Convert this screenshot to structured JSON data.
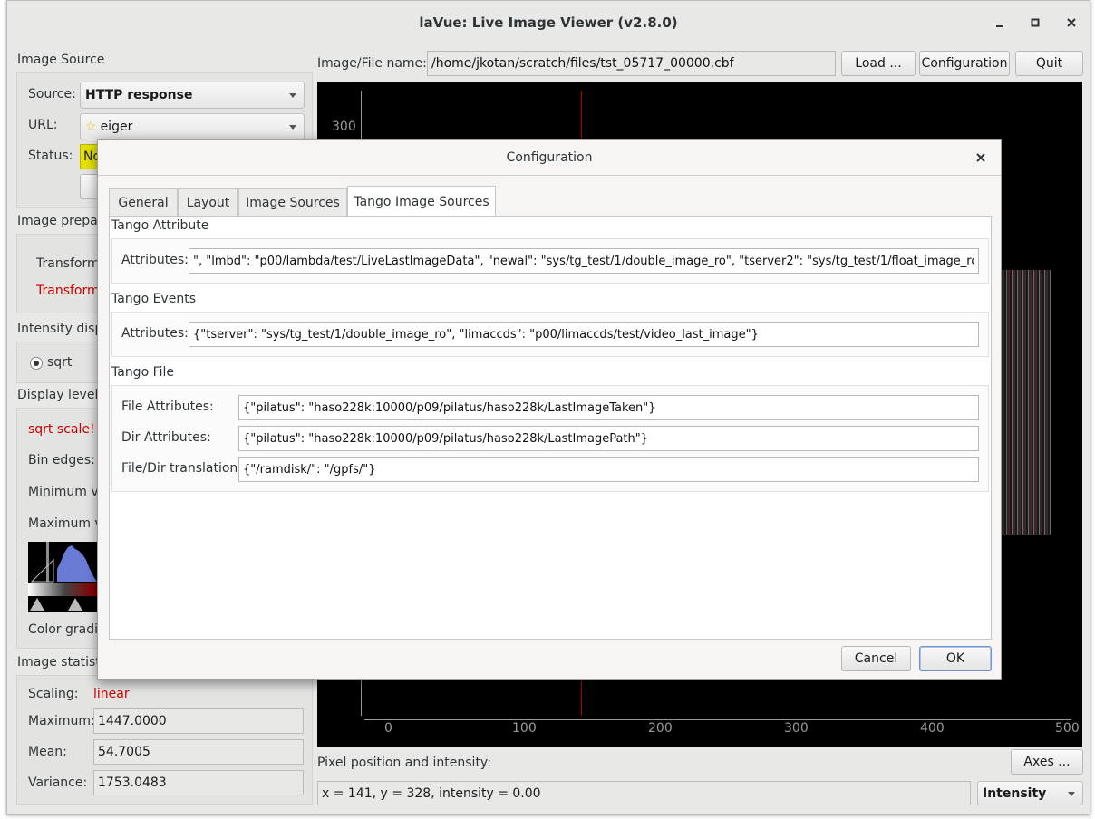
{
  "window": {
    "title": "laVue: Live Image Viewer (v2.8.0)",
    "controls": [
      "minimize-icon",
      "maximize-icon",
      "close-icon"
    ]
  },
  "left": {
    "image_source": {
      "title": "Image Source",
      "source_label": "Source:",
      "source_value": "HTTP response",
      "url_label": "URL:",
      "url_value": "eiger",
      "status_label": "Status:",
      "status_value": "No"
    },
    "image_preparation": {
      "title": "Image prepara",
      "transform_label": "Transforma",
      "transform_red": "Transform"
    },
    "intensity": {
      "title": "Intensity displ",
      "radio_label": "sqrt"
    },
    "display_levels": {
      "title": "Display levels",
      "scale_note": "sqrt scale!",
      "bin_edges_label": "Bin edges:",
      "min_label": "Minimum va",
      "max_label": "Maximum va",
      "gradient_label": "Color gradie"
    },
    "statistics": {
      "title": "Image statistic",
      "scaling_label": "Scaling:",
      "scaling_value": "linear",
      "maximum_label": "Maximum:",
      "maximum_value": "1447.0000",
      "mean_label": "Mean:",
      "mean_value": "54.7005",
      "variance_label": "Variance:",
      "variance_value": "1753.0483"
    }
  },
  "top": {
    "file_label": "Image/File name:",
    "file_value": "/home/jkotan/scratch/files/tst_05717_00000.cbf",
    "load_label": "Load ...",
    "config_label": "Configuration",
    "quit_label": "Quit"
  },
  "plot": {
    "y_tick_top": "300",
    "x_ticks": [
      "0",
      "100",
      "200",
      "300",
      "400",
      "500"
    ]
  },
  "bottom": {
    "pixel_label": "Pixel position and intensity:",
    "axes_label": "Axes ...",
    "pixel_value": "x = 141, y = 328, intensity = 0.00",
    "mode_value": "Intensity"
  },
  "dialog": {
    "title": "Configuration",
    "tabs": [
      "General",
      "Layout",
      "Image Sources",
      "Tango Image Sources"
    ],
    "active_tab": "Tango Image Sources",
    "tango_attribute": {
      "title": "Tango Attribute",
      "attributes_label": "Attributes:",
      "attributes_value": "\", \"lmbd\": \"p00/lambda/test/LiveLastImageData\", \"newal\": \"sys/tg_test/1/double_image_ro\", \"tserver2\": \"sys/tg_test/1/float_image_ro\"}"
    },
    "tango_events": {
      "title": "Tango Events",
      "attributes_label": "Attributes:",
      "attributes_value": "{\"tserver\": \"sys/tg_test/1/double_image_ro\", \"limaccds\": \"p00/limaccds/test/video_last_image\"}"
    },
    "tango_file": {
      "title": "Tango File",
      "file_attr_label": "File Attributes:",
      "file_attr_value": "{\"pilatus\": \"haso228k:10000/p09/pilatus/haso228k/LastImageTaken\"}",
      "dir_attr_label": "Dir Attributes:",
      "dir_attr_value": "{\"pilatus\": \"haso228k:10000/p09/pilatus/haso228k/LastImagePath\"}",
      "translation_label": "File/Dir translation:",
      "translation_value": "{\"/ramdisk/\": \"/gpfs/\"}"
    },
    "cancel_label": "Cancel",
    "ok_label": "OK"
  }
}
